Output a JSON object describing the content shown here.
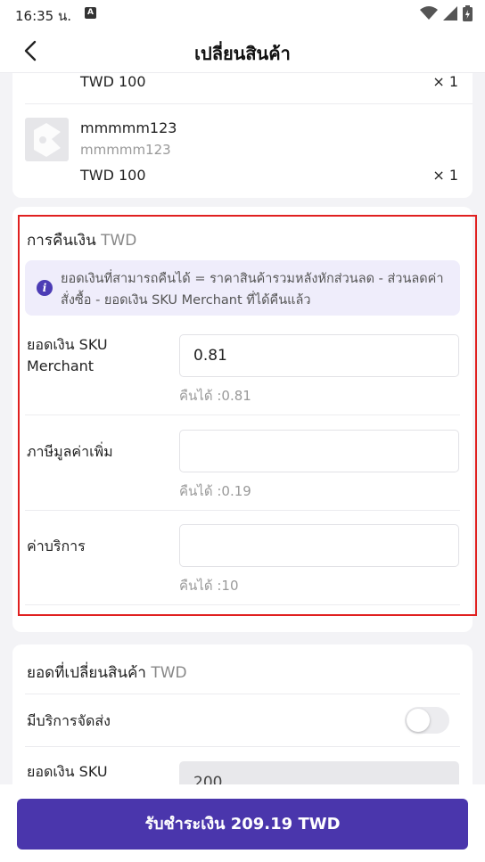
{
  "status_bar": {
    "time": "16:35 น.",
    "a_badge": "A"
  },
  "header": {
    "title": "เปลี่ยนสินค้า"
  },
  "products": {
    "first_price": "TWD 100",
    "first_qty": "× 1",
    "item": {
      "name": "mmmmm123",
      "variant": "mmmmm123",
      "price": "TWD 100",
      "qty": "× 1"
    }
  },
  "refund": {
    "title": "การคืนเงิน",
    "unit": "TWD",
    "info": "ยอดเงินที่สามารถคืนได้ = ราคาสินค้ารวมหลังหักส่วนลด - ส่วนลดค่าสั่งซื้อ - ยอดเงิน SKU Merchant ที่ได้คืนแล้ว",
    "fields": [
      {
        "label": "ยอดเงิน SKU Merchant",
        "value": "0.81",
        "refundable": "คืนได้ :0.81"
      },
      {
        "label": "ภาษีมูลค่าเพิ่ม",
        "value": "",
        "refundable": "คืนได้ :0.19"
      },
      {
        "label": "ค่าบริการ",
        "value": "",
        "refundable": "คืนได้ :10"
      }
    ]
  },
  "exchange": {
    "title": "ยอดที่เปลี่ยนสินค้า",
    "unit": "TWD",
    "shipping_label": "มีบริการจัดส่ง",
    "shipping_enabled": false,
    "sku_label": "ยอดเงิน SKU",
    "sku_value": "200"
  },
  "footer": {
    "pay_label": "รับชำระเงิน 209.19 TWD"
  }
}
